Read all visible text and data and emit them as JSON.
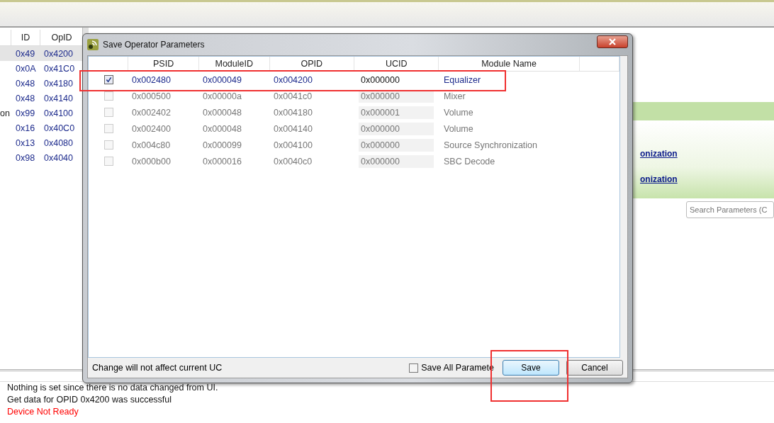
{
  "left_table": {
    "columns": [
      "ID",
      "OpID"
    ],
    "rows": [
      {
        "id": "0x49",
        "opid": "0x4200",
        "selected": true
      },
      {
        "id": "0x0A",
        "opid": "0x41C0",
        "selected": false
      },
      {
        "id": "0x48",
        "opid": "0x4180",
        "selected": false
      },
      {
        "id": "0x48",
        "opid": "0x4140",
        "selected": false
      },
      {
        "column_1": "on",
        "id": "0x99",
        "opid": "0x4100",
        "selected": false
      },
      {
        "id": "0x16",
        "opid": "0x40C0",
        "selected": false
      },
      {
        "id": "0x13",
        "opid": "0x4080",
        "selected": false
      },
      {
        "id": "0x98",
        "opid": "0x4040",
        "selected": false
      }
    ]
  },
  "right_panel": {
    "links": [
      "onization",
      "onization"
    ],
    "search": {
      "placeholder": "Search Parameters (C"
    }
  },
  "log": [
    {
      "text": "Nothing is set since there is no data changed from UI.",
      "kind": "info"
    },
    {
      "text": "Get data for OPID 0x4200 was successful",
      "kind": "info"
    },
    {
      "text": "Device Not Ready",
      "kind": "error"
    }
  ],
  "dialog": {
    "title": "Save Operator Parameters",
    "columns": [
      "PSID",
      "ModuleID",
      "OPID",
      "UCID",
      "Module Name"
    ],
    "rows": [
      {
        "checked": true,
        "disabled": false,
        "cells": [
          "0x002480",
          "0x000049",
          "0x004200",
          "0x000000",
          "Equalizer"
        ]
      },
      {
        "checked": false,
        "disabled": true,
        "cells": [
          "0x000500",
          "0x00000a",
          "0x0041c0",
          "0x000000",
          "Mixer"
        ]
      },
      {
        "checked": false,
        "disabled": true,
        "cells": [
          "0x002402",
          "0x000048",
          "0x004180",
          "0x000001",
          "Volume"
        ]
      },
      {
        "checked": false,
        "disabled": true,
        "cells": [
          "0x002400",
          "0x000048",
          "0x004140",
          "0x000000",
          "Volume"
        ]
      },
      {
        "checked": false,
        "disabled": true,
        "cells": [
          "0x004c80",
          "0x000099",
          "0x004100",
          "0x000000",
          "Source Synchronization"
        ]
      },
      {
        "checked": false,
        "disabled": true,
        "cells": [
          "0x000b00",
          "0x000016",
          "0x0040c0",
          "0x000000",
          "SBC Decode"
        ]
      }
    ],
    "note": "Change will not affect current UC",
    "save_all": {
      "label": "Save All Paramete",
      "checked": false
    },
    "buttons": [
      {
        "label": "Save",
        "default": true
      },
      {
        "label": "Cancel",
        "default": false
      }
    ]
  }
}
